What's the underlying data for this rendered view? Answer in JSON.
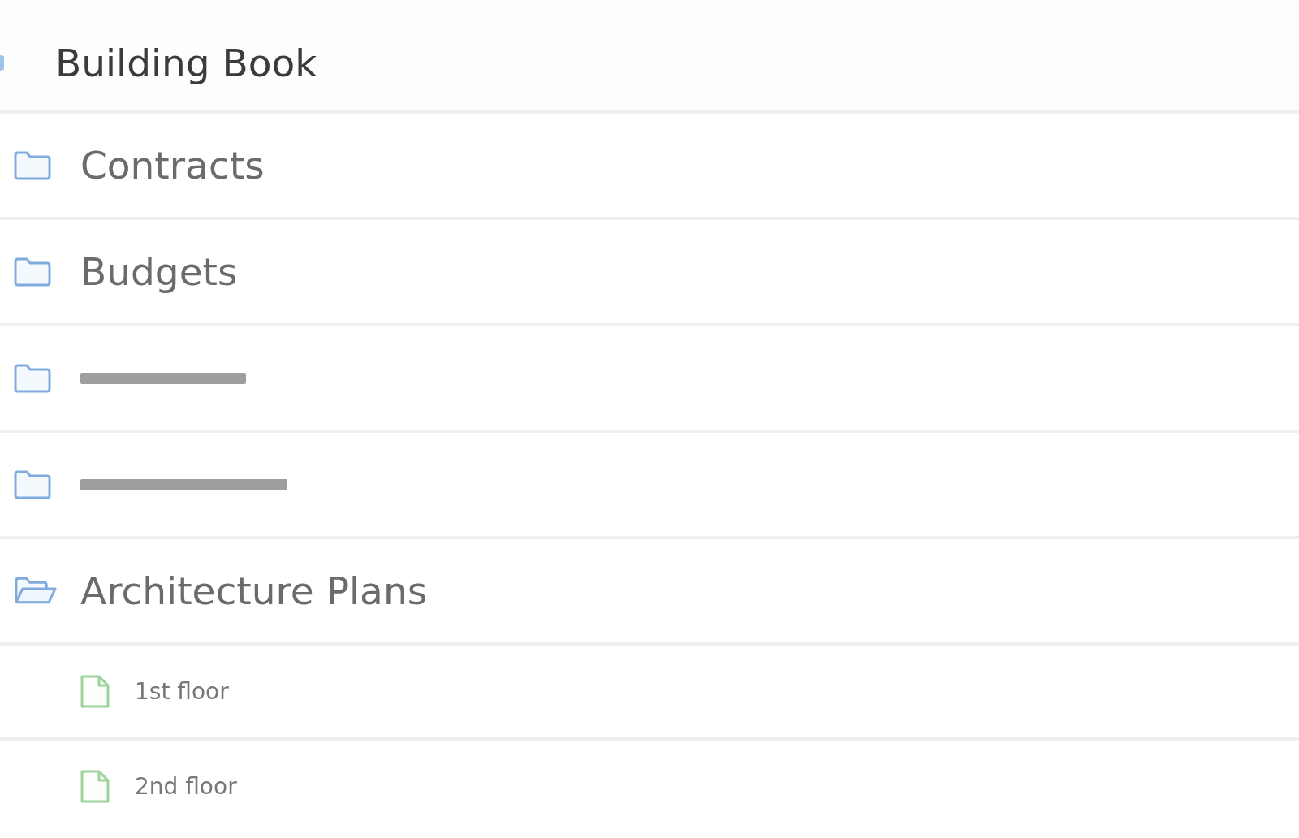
{
  "header": {
    "title": "Building Book"
  },
  "tree": [
    {
      "kind": "folder",
      "label": "Contracts",
      "redacted": false,
      "expanded": false
    },
    {
      "kind": "folder",
      "label": "Budgets",
      "redacted": false,
      "expanded": false
    },
    {
      "kind": "folder",
      "redacted": true,
      "expanded": false
    },
    {
      "kind": "folder",
      "redacted": true,
      "expanded": false
    },
    {
      "kind": "folder",
      "label": "Architecture Plans",
      "redacted": false,
      "expanded": true,
      "children": [
        {
          "kind": "file",
          "label": "1st floor"
        },
        {
          "kind": "file",
          "label": "2nd floor"
        }
      ]
    }
  ]
}
